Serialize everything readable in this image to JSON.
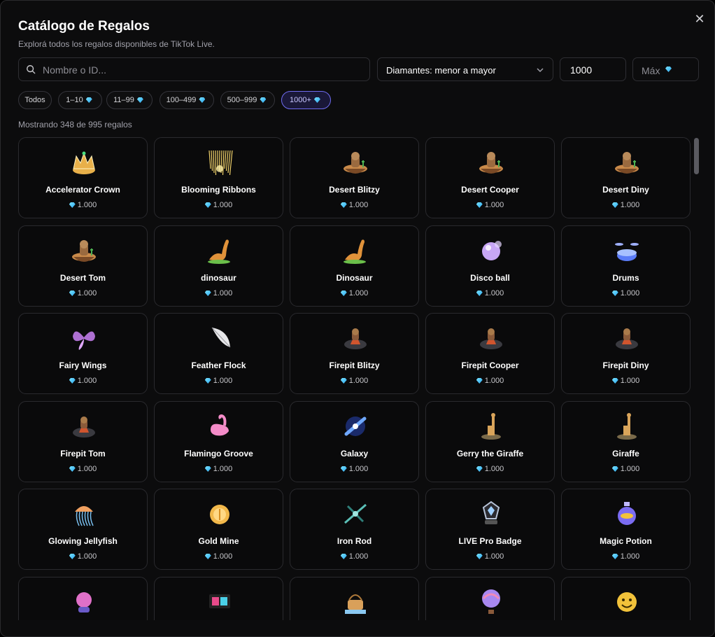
{
  "header": {
    "title": "Catálogo de Regalos",
    "subtitle": "Explorá todos los regalos disponibles de TikTok Live.",
    "close_symbol": "✕"
  },
  "filters": {
    "search_placeholder": "Nombre o ID...",
    "sort_label": "Diamantes: menor a mayor",
    "min_value": "1000",
    "max_placeholder": "Máx",
    "chips": [
      {
        "label": "Todos",
        "gem": false,
        "active": false
      },
      {
        "label": "1–10",
        "gem": true,
        "active": false
      },
      {
        "label": "11–99",
        "gem": true,
        "active": false
      },
      {
        "label": "100–499",
        "gem": true,
        "active": false
      },
      {
        "label": "500–999",
        "gem": true,
        "active": false
      },
      {
        "label": "1000+",
        "gem": true,
        "active": true
      }
    ]
  },
  "count_text": "Mostrando 348 de 995 regalos",
  "gifts": [
    {
      "name": "Accelerator Crown",
      "price": "1.000",
      "icon": "crown-icon",
      "color": "#e8b04a"
    },
    {
      "name": "Blooming Ribbons",
      "price": "1.000",
      "icon": "ribbons-icon",
      "color": "#f2d36b"
    },
    {
      "name": "Desert Blitzy",
      "price": "1.000",
      "icon": "desert-island-icon",
      "color": "#c98a4a"
    },
    {
      "name": "Desert Cooper",
      "price": "1.000",
      "icon": "desert-island-icon",
      "color": "#c98a4a"
    },
    {
      "name": "Desert Diny",
      "price": "1.000",
      "icon": "desert-island-icon",
      "color": "#c98a4a"
    },
    {
      "name": "Desert Tom",
      "price": "1.000",
      "icon": "desert-island-icon",
      "color": "#c98a4a"
    },
    {
      "name": "dinosaur",
      "price": "1.000",
      "icon": "dinosaur-icon",
      "color": "#e0923a"
    },
    {
      "name": "Dinosaur",
      "price": "1.000",
      "icon": "dinosaur-icon",
      "color": "#e0923a"
    },
    {
      "name": "Disco ball",
      "price": "1.000",
      "icon": "disco-ball-icon",
      "color": "#c7a6f5"
    },
    {
      "name": "Drums",
      "price": "1.000",
      "icon": "drums-icon",
      "color": "#5b7cf7"
    },
    {
      "name": "Fairy Wings",
      "price": "1.000",
      "icon": "wings-icon",
      "color": "#c07be8"
    },
    {
      "name": "Feather Flock",
      "price": "1.000",
      "icon": "feather-icon",
      "color": "#e8e8ea"
    },
    {
      "name": "Firepit Blitzy",
      "price": "1.000",
      "icon": "firepit-icon",
      "color": "#d0552e"
    },
    {
      "name": "Firepit Cooper",
      "price": "1.000",
      "icon": "firepit-icon",
      "color": "#d0552e"
    },
    {
      "name": "Firepit Diny",
      "price": "1.000",
      "icon": "firepit-icon",
      "color": "#d0552e"
    },
    {
      "name": "Firepit Tom",
      "price": "1.000",
      "icon": "firepit-icon",
      "color": "#d0552e"
    },
    {
      "name": "Flamingo Groove",
      "price": "1.000",
      "icon": "flamingo-icon",
      "color": "#f48cc8"
    },
    {
      "name": "Galaxy",
      "price": "1.000",
      "icon": "galaxy-icon",
      "color": "#6fa8ff"
    },
    {
      "name": "Gerry the Giraffe",
      "price": "1.000",
      "icon": "giraffe-icon",
      "color": "#d9a45a"
    },
    {
      "name": "Giraffe",
      "price": "1.000",
      "icon": "giraffe-icon",
      "color": "#d9a45a"
    },
    {
      "name": "Glowing Jellyfish",
      "price": "1.000",
      "icon": "jellyfish-icon",
      "color": "#f0a060"
    },
    {
      "name": "Gold Mine",
      "price": "1.000",
      "icon": "gold-mine-icon",
      "color": "#f2b84a"
    },
    {
      "name": "Iron Rod",
      "price": "1.000",
      "icon": "iron-rod-icon",
      "color": "#5bc0b8"
    },
    {
      "name": "LIVE Pro Badge",
      "price": "1.000",
      "icon": "badge-icon",
      "color": "#b8c4d8"
    },
    {
      "name": "Magic Potion",
      "price": "1.000",
      "icon": "potion-icon",
      "color": "#7b6cf2"
    },
    {
      "name": "",
      "price": "",
      "icon": "crystal-ball-icon",
      "color": "#e070c8"
    },
    {
      "name": "",
      "price": "",
      "icon": "film-icon",
      "color": "#e84a8a"
    },
    {
      "name": "",
      "price": "",
      "icon": "picnic-basket-icon",
      "color": "#d9a05a"
    },
    {
      "name": "",
      "price": "",
      "icon": "hot-air-balloon-icon",
      "color": "#a888f0"
    },
    {
      "name": "",
      "price": "",
      "icon": "emoji-coins-icon",
      "color": "#f2c23a"
    }
  ]
}
